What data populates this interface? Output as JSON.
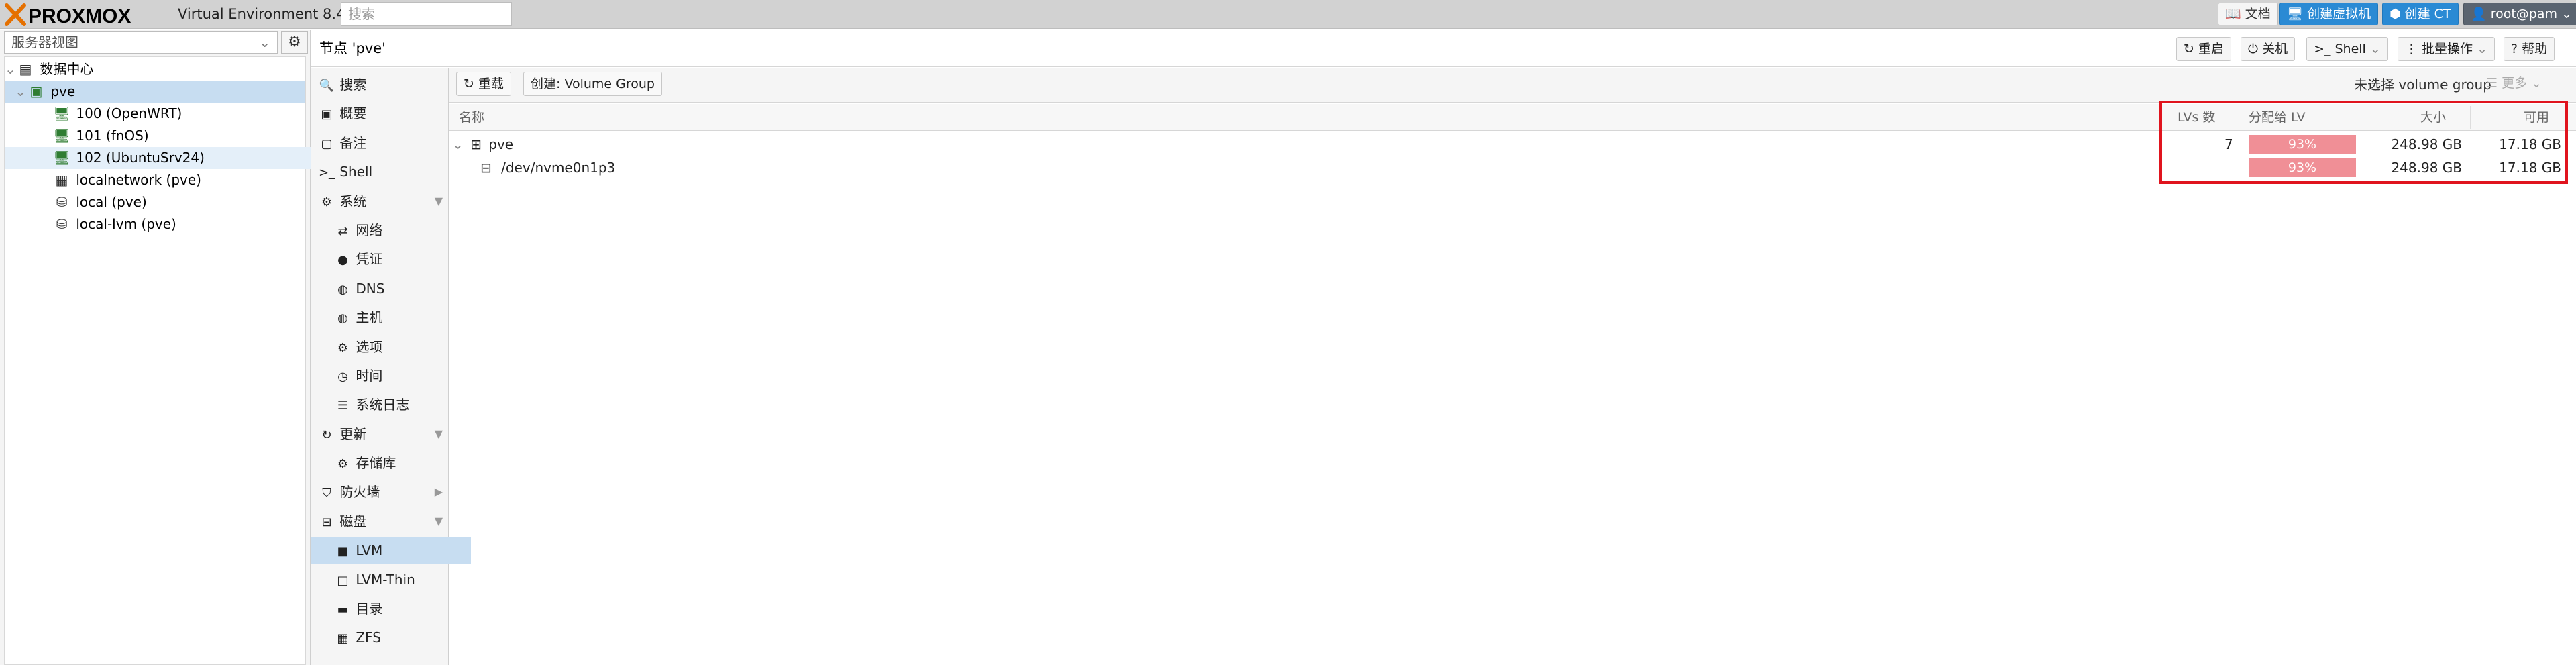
{
  "header": {
    "logo_text": "PROXMOX",
    "version": "Virtual Environment 8.4.5",
    "search_placeholder": "搜索",
    "docs": "文档",
    "create_vm": "创建虚拟机",
    "create_ct": "创建 CT",
    "user": "root@pam"
  },
  "left": {
    "view": "服务器视图",
    "tree": [
      {
        "label": "数据中心",
        "icon": "datacenter-icon"
      },
      {
        "label": "pve",
        "icon": "node-icon"
      },
      {
        "label": "100 (OpenWRT)",
        "icon": "vm-running-icon"
      },
      {
        "label": "101 (fnOS)",
        "icon": "vm-running-icon"
      },
      {
        "label": "102 (UbuntuSrv24)",
        "icon": "vm-running-icon"
      },
      {
        "label": "localnetwork (pve)",
        "icon": "network-icon"
      },
      {
        "label": "local (pve)",
        "icon": "storage-icon"
      },
      {
        "label": "local-lvm (pve)",
        "icon": "storage-icon"
      }
    ]
  },
  "node": {
    "title": "节点 'pve'",
    "restart": "重启",
    "shutdown": "关机",
    "shell": "Shell",
    "bulk": "批量操作",
    "help": "帮助"
  },
  "nav": [
    {
      "label": "搜索",
      "icon": "search-icon"
    },
    {
      "label": "概要",
      "icon": "summary-icon"
    },
    {
      "label": "备注",
      "icon": "notes-icon"
    },
    {
      "label": "Shell",
      "icon": "terminal-icon"
    },
    {
      "label": "系统",
      "icon": "gears-icon"
    },
    {
      "label": "网络",
      "icon": "network-icon"
    },
    {
      "label": "凭证",
      "icon": "certificate-icon"
    },
    {
      "label": "DNS",
      "icon": "globe-icon"
    },
    {
      "label": "主机",
      "icon": "globe-icon"
    },
    {
      "label": "选项",
      "icon": "gear-icon"
    },
    {
      "label": "时间",
      "icon": "clock-icon"
    },
    {
      "label": "系统日志",
      "icon": "list-icon"
    },
    {
      "label": "更新",
      "icon": "refresh-icon"
    },
    {
      "label": "存储库",
      "icon": "repository-icon"
    },
    {
      "label": "防火墙",
      "icon": "shield-icon"
    },
    {
      "label": "磁盘",
      "icon": "disk-icon"
    },
    {
      "label": "LVM",
      "icon": "lvm-icon"
    },
    {
      "label": "LVM-Thin",
      "icon": "lvm-thin-icon"
    },
    {
      "label": "目录",
      "icon": "folder-icon"
    },
    {
      "label": "ZFS",
      "icon": "zfs-icon"
    }
  ],
  "main": {
    "reload": "重载",
    "create_vg": "创建: Volume Group",
    "no_selection": "未选择 volume group",
    "more": "更多",
    "columns": {
      "name": "名称",
      "lvs": "LVs 数",
      "assigned": "分配给 LV",
      "size": "大小",
      "free": "可用"
    },
    "rows": [
      {
        "name": "pve",
        "lvs": "7",
        "assigned": "93%",
        "assigned_fraction": 0.93,
        "size": "248.98 GB",
        "free": "17.18 GB"
      },
      {
        "name": "/dev/nvme0n1p3",
        "lvs": "",
        "assigned": "93%",
        "assigned_fraction": 0.93,
        "size": "248.98 GB",
        "free": "17.18 GB"
      }
    ]
  }
}
